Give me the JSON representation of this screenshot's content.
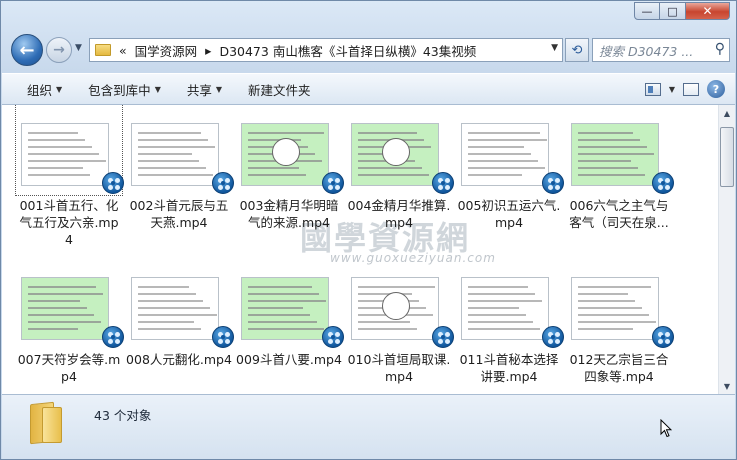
{
  "window": {
    "caption_buttons": {
      "minimize": "—",
      "maximize": "□",
      "close": "✕"
    }
  },
  "nav": {
    "back_icon": "back-arrow-icon",
    "forward_icon": "forward-arrow-icon",
    "address_prefix": "«",
    "breadcrumb": [
      "国学资源网",
      "D30473 南山樵客《斗首择日纵横》43集视频"
    ],
    "breadcrumb_sep": "▸",
    "search_placeholder": "搜索 D30473 ..."
  },
  "toolbar": {
    "items": [
      {
        "label": "组织",
        "has_caret": true
      },
      {
        "label": "包含到库中",
        "has_caret": true
      },
      {
        "label": "共享",
        "has_caret": true
      },
      {
        "label": "新建文件夹",
        "has_caret": false
      }
    ]
  },
  "files": [
    {
      "name": "001斗首五行、化气五行及六亲.mp4",
      "thumb": "white",
      "selected": true
    },
    {
      "name": "002斗首元辰与五天燕.mp4",
      "thumb": "white",
      "selected": false
    },
    {
      "name": "003金精月华明暗气的来源.mp4",
      "thumb": "green",
      "selected": false
    },
    {
      "name": "004金精月华推算.mp4",
      "thumb": "green",
      "selected": false
    },
    {
      "name": "005初识五运六气.mp4",
      "thumb": "white",
      "selected": false
    },
    {
      "name": "006六气之主气与客气（司天在泉...",
      "thumb": "green",
      "selected": false
    },
    {
      "name": "007天符岁会等.mp4",
      "thumb": "green",
      "selected": false
    },
    {
      "name": "008人元翻化.mp4",
      "thumb": "white",
      "selected": false
    },
    {
      "name": "009斗首八要.mp4",
      "thumb": "green",
      "selected": false
    },
    {
      "name": "010斗首垣局取课.mp4",
      "thumb": "white",
      "selected": false
    },
    {
      "name": "011斗首秘本选择讲要.mp4",
      "thumb": "white",
      "selected": false
    },
    {
      "name": "012天乙宗旨三合四象等.mp4",
      "thumb": "white",
      "selected": false
    }
  ],
  "watermark": {
    "text": "國學資源網",
    "url": "www.guoxueziyuan.com"
  },
  "status": {
    "count_text": "43 个对象"
  }
}
